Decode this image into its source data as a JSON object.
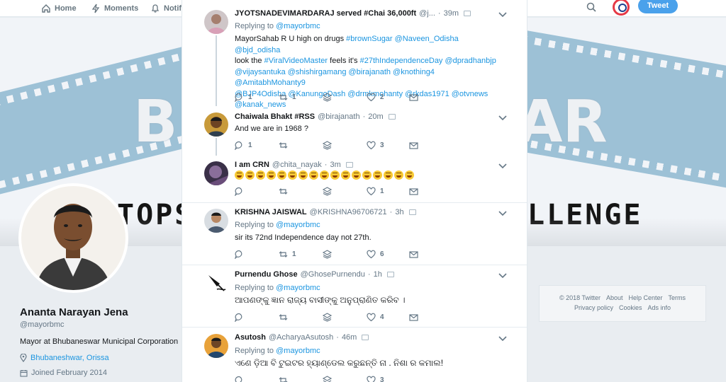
{
  "nav": {
    "home": "Home",
    "moments": "Moments",
    "notifications": "Notifi",
    "tweet_button": "Tweet"
  },
  "banner": {
    "big_left": "B",
    "big_right": "AR",
    "strip_left": "TOPS",
    "strip_right": "LLENGE"
  },
  "profile": {
    "name": "Ananta Narayan Jena",
    "handle": "@mayorbmc",
    "bio": "Mayor at Bhubaneswar Municipal Corporation",
    "location": "Bhubaneshwar, Orissa",
    "joined": "Joined February 2014"
  },
  "footer": {
    "row1": [
      "© 2018 Twitter",
      "About",
      "Help Center",
      "Terms"
    ],
    "row2": [
      "Privacy policy",
      "Cookies",
      "Ads info"
    ]
  },
  "replying_label": "Replying to",
  "replying_handle": "@mayorbmc",
  "tweets": [
    {
      "name": "JYOTSNADEVIMARDARAJ served #Chai 36,000ft",
      "handle": "@j...",
      "time": "39m",
      "text_plain": "MayorSahab R U high on drugs",
      "text_tags1": "#brownSugar @Naveen_Odisha @bjd_odisha",
      "text_plain2": "look the",
      "text_tags2": "#ViralVideoMaster",
      "text_plain3": "feels it's",
      "text_tags3": "#27thIndependenceDay @dpradhanbjp",
      "text_line3": "@vijaysantuka @shishirgamang @birajanath @knothing4 @AmitabhMohanty9",
      "text_line4": "@BJP4Odisha @KanungoDash @drmkmohanty @rkdas1971 @otvnews",
      "text_line5": "@kanak_news",
      "replies": "1",
      "retweets": "1",
      "likes": "2"
    },
    {
      "name": "Chaiwala Bhakt #RSS",
      "handle": "@birajanath",
      "time": "20m",
      "text": "And we are in 1968 ?",
      "replies": "1",
      "likes": "3"
    },
    {
      "name": "I am CRN",
      "handle": "@chita_nayak",
      "time": "3m",
      "emoji_count": 17,
      "likes": "1"
    },
    {
      "name": "KRISHNA JAISWAL",
      "handle": "@KRISHNA96706721",
      "time": "3h",
      "text": "sir its 72nd Independence day not 27th.",
      "retweets": "1",
      "likes": "6"
    },
    {
      "name": "Purnendu Ghose",
      "handle": "@GhosePurnendu",
      "time": "1h",
      "text": "ଆପଣଙ୍କୁ ଜ୍ଞାନ ରାଜ୍ୟ ବାସୀଙ୍କୁ ଅନୁପ୍ରାଣିତ କରିବ ।",
      "likes": "4"
    },
    {
      "name": "Asutosh",
      "handle": "@AcharyaAsutosh",
      "time": "46m",
      "text": "ଏଣେ ଡ଼ିଆ ବି ଟୁଇଟର ହ୍ୟାଣ୍ଡେଲ କରୁଛନ୍ତି ନା . ନିଶା ର କମାଲ!",
      "likes": "3"
    }
  ]
}
